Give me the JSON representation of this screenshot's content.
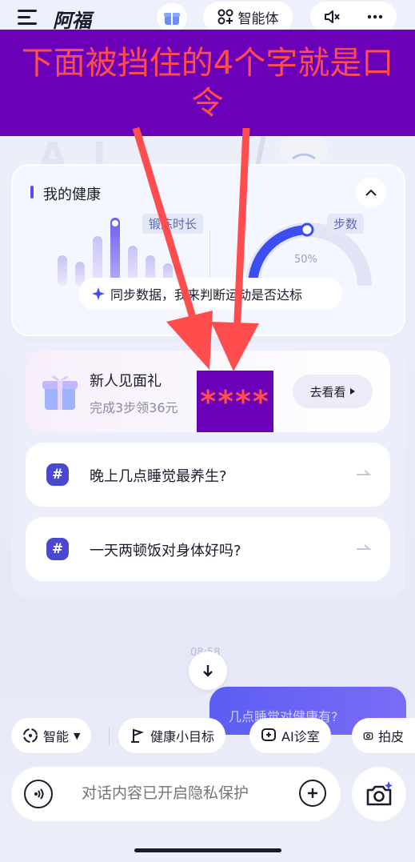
{
  "header": {
    "app_title": "阿福",
    "agent_label": "智能体"
  },
  "banner": {
    "text": "下面被挡住的4个字就是口令"
  },
  "health": {
    "title": "我的健康",
    "exercise_tag": "锻炼时长",
    "steps_tag": "步数",
    "gauge_percent": "50%",
    "sync_text": "同步数据，我来判断运动是否达标"
  },
  "gift": {
    "title": "新人见面礼",
    "subtitle": "完成3步领36元",
    "button": "去看看",
    "mask_text": "****"
  },
  "questions": [
    {
      "text": "晚上几点睡觉最养生?"
    },
    {
      "text": "一天两顿饭对身体好吗?"
    }
  ],
  "chat": {
    "time_label": "08:58",
    "user_bubble": "几点睡觉对健康有?"
  },
  "chips": [
    {
      "label": "智能",
      "icon": "smart-mode-icon"
    },
    {
      "label": "健康小目标",
      "icon": "goal-icon"
    },
    {
      "label": "AI诊室",
      "icon": "ai-clinic-icon"
    },
    {
      "label": "拍皮",
      "icon": "camera-icon"
    }
  ],
  "input": {
    "placeholder": "对话内容已开启隐私保护"
  },
  "colors": {
    "banner_bg": "#6a00b8",
    "banner_text": "#ff4d4d",
    "accent": "#4a48cf",
    "arrow": "#ff4d4d"
  }
}
